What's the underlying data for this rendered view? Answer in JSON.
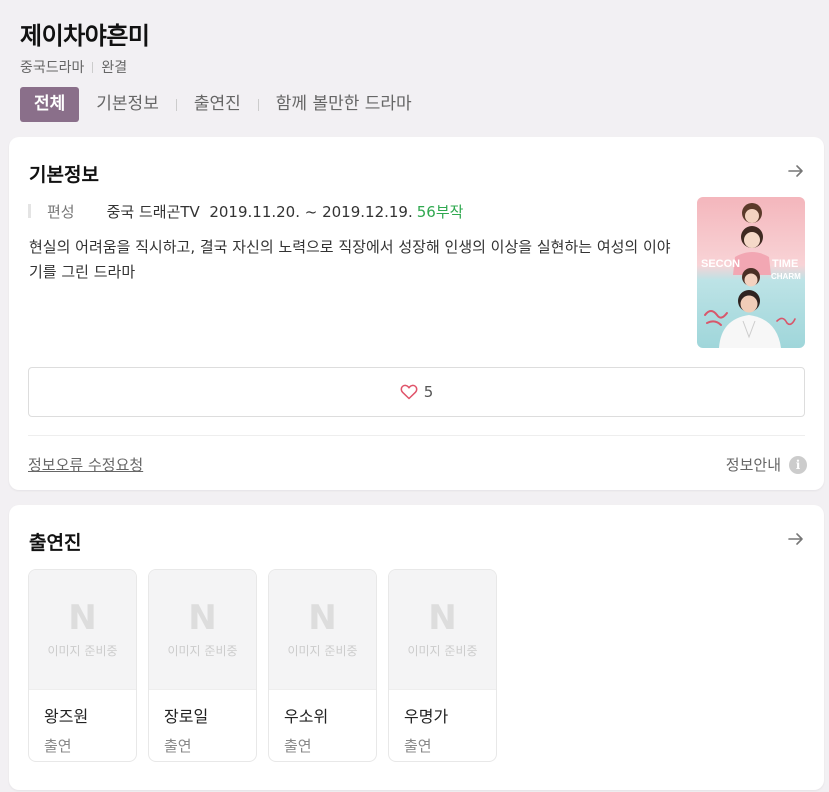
{
  "header": {
    "title": "제이차야흔미",
    "category": "중국드라마",
    "status": "완결"
  },
  "tabs": [
    {
      "label": "전체",
      "active": true
    },
    {
      "label": "기본정보"
    },
    {
      "label": "출연진"
    },
    {
      "label": "함께 볼만한 드라마"
    }
  ],
  "basic_info": {
    "title": "기본정보",
    "label": "편성",
    "broadcast": "중국 드래곤TV  2019.11.20. ~ 2019.12.19.",
    "episodes": "56부작",
    "description": "현실의 어려움을 직시하고, 결국 자신의 노력으로 직장에서 성장해 인생의 이상을 실현하는 여성의 이야기를 그린 드라마",
    "poster_text_left": "SECON",
    "poster_text_right": "TIME",
    "poster_text_sub": "CHARM",
    "likes": "5",
    "report_label": "정보오류 수정요청",
    "guide_label": "정보안내",
    "guide_icon": "i"
  },
  "cast_section": {
    "title": "출연진",
    "placeholder_logo": "N",
    "placeholder_text": "이미지 준비중",
    "members": [
      {
        "name": "왕즈원",
        "role": "출연"
      },
      {
        "name": "장로일",
        "role": "출연"
      },
      {
        "name": "우소위",
        "role": "출연"
      },
      {
        "name": "우명가",
        "role": "출연"
      }
    ]
  },
  "colors": {
    "accent": "#8a6f8a",
    "green": "#2fa84f",
    "heart": "#e0546a",
    "background": "#f2f0f3"
  }
}
